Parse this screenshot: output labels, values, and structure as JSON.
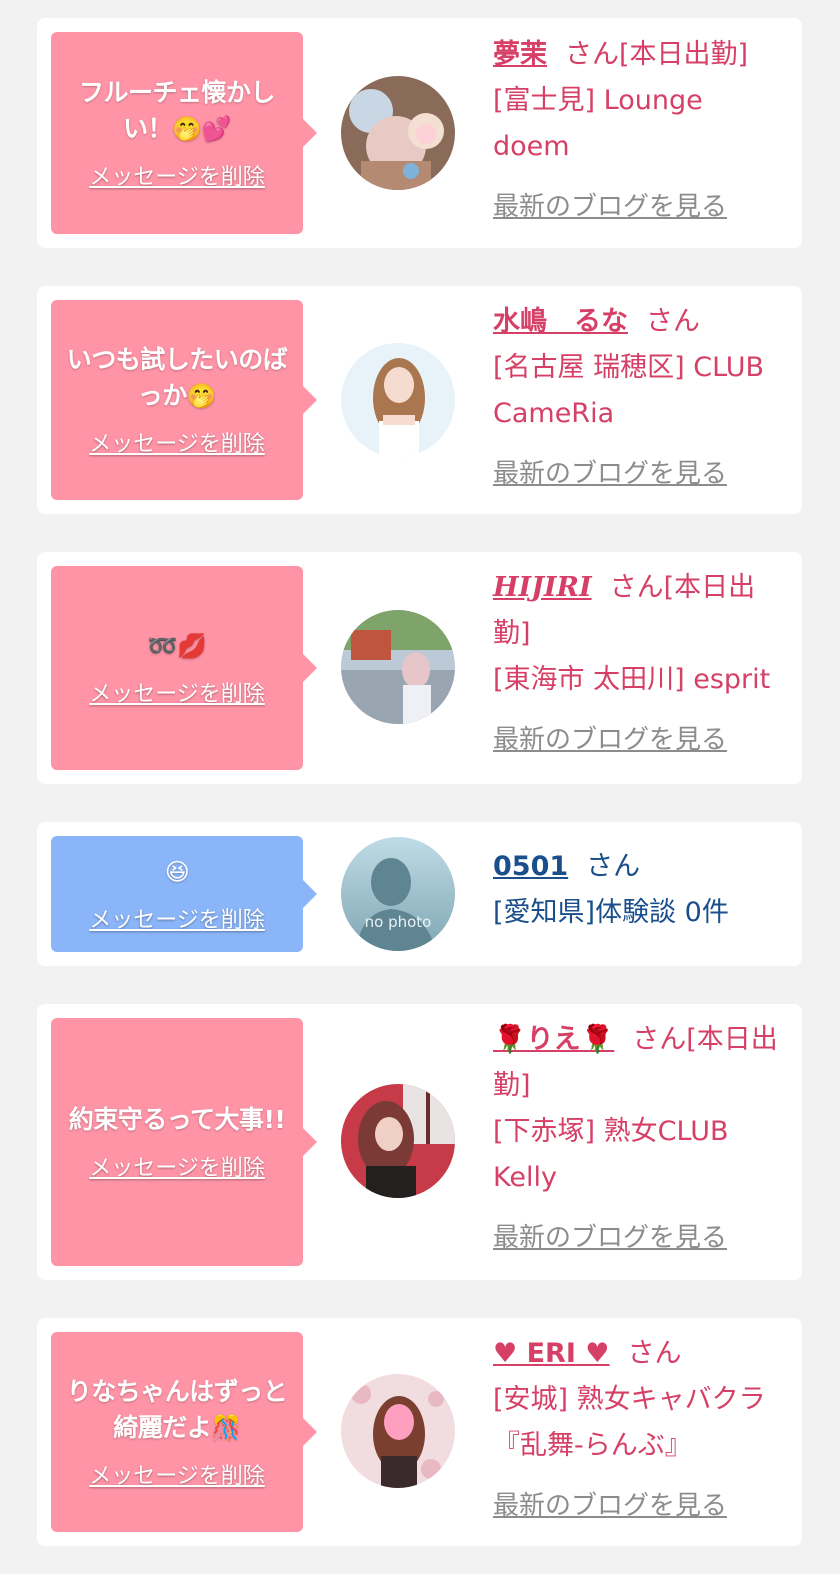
{
  "delete_label": "メッセージを削除",
  "blog_label": "最新のブログを見る",
  "no_photo_label": "no photo",
  "colors": {
    "pink_bubble": "#ff94a7",
    "blue_bubble": "#8ab5f9",
    "pink_text": "#d64067",
    "blue_text": "#1b4f8c",
    "gray_link": "#8c8c8c"
  },
  "messages": [
    {
      "bubble_text": "フルーチェ懐かしい！",
      "bubble_emoji": "🤭💕",
      "name": "夢茉",
      "suffix": "さん[本日出勤]",
      "shop": "[富士見] Lounge doem",
      "avatar_icon": "photo-avatar"
    },
    {
      "bubble_text": "いつも試したいのばっか",
      "bubble_emoji": "🤭",
      "name": "水嶋　るな",
      "suffix": "さん",
      "shop": "[名古屋 瑞穂区] CLUB CameRia",
      "avatar_icon": "photo-avatar"
    },
    {
      "bubble_text": "",
      "bubble_emoji": "➿💋",
      "name": "HIJIRI",
      "suffix": "さん[本日出勤]",
      "shop": "[東海市 太田川] esprit",
      "avatar_icon": "photo-avatar"
    },
    {
      "bubble_text": "",
      "bubble_emoji": "😆",
      "name": "0501",
      "suffix": "さん",
      "shop": "[愛知県]体験談 0件",
      "avatar_icon": "no-photo-avatar"
    },
    {
      "bubble_text": "約束守るって大事!!",
      "bubble_emoji": "",
      "name": "🌹りえ🌹",
      "suffix": "さん[本日出勤]",
      "shop": "[下赤塚] 熟女CLUB Kelly",
      "avatar_icon": "photo-avatar"
    },
    {
      "bubble_text": "りなちゃんはずっと綺麗だよ",
      "bubble_emoji": "🎊",
      "name": "♥ ERI ♥",
      "suffix": "さん",
      "shop": "[安城] 熟女キャバクラ『乱舞-らんぶ』",
      "avatar_icon": "photo-avatar"
    }
  ]
}
